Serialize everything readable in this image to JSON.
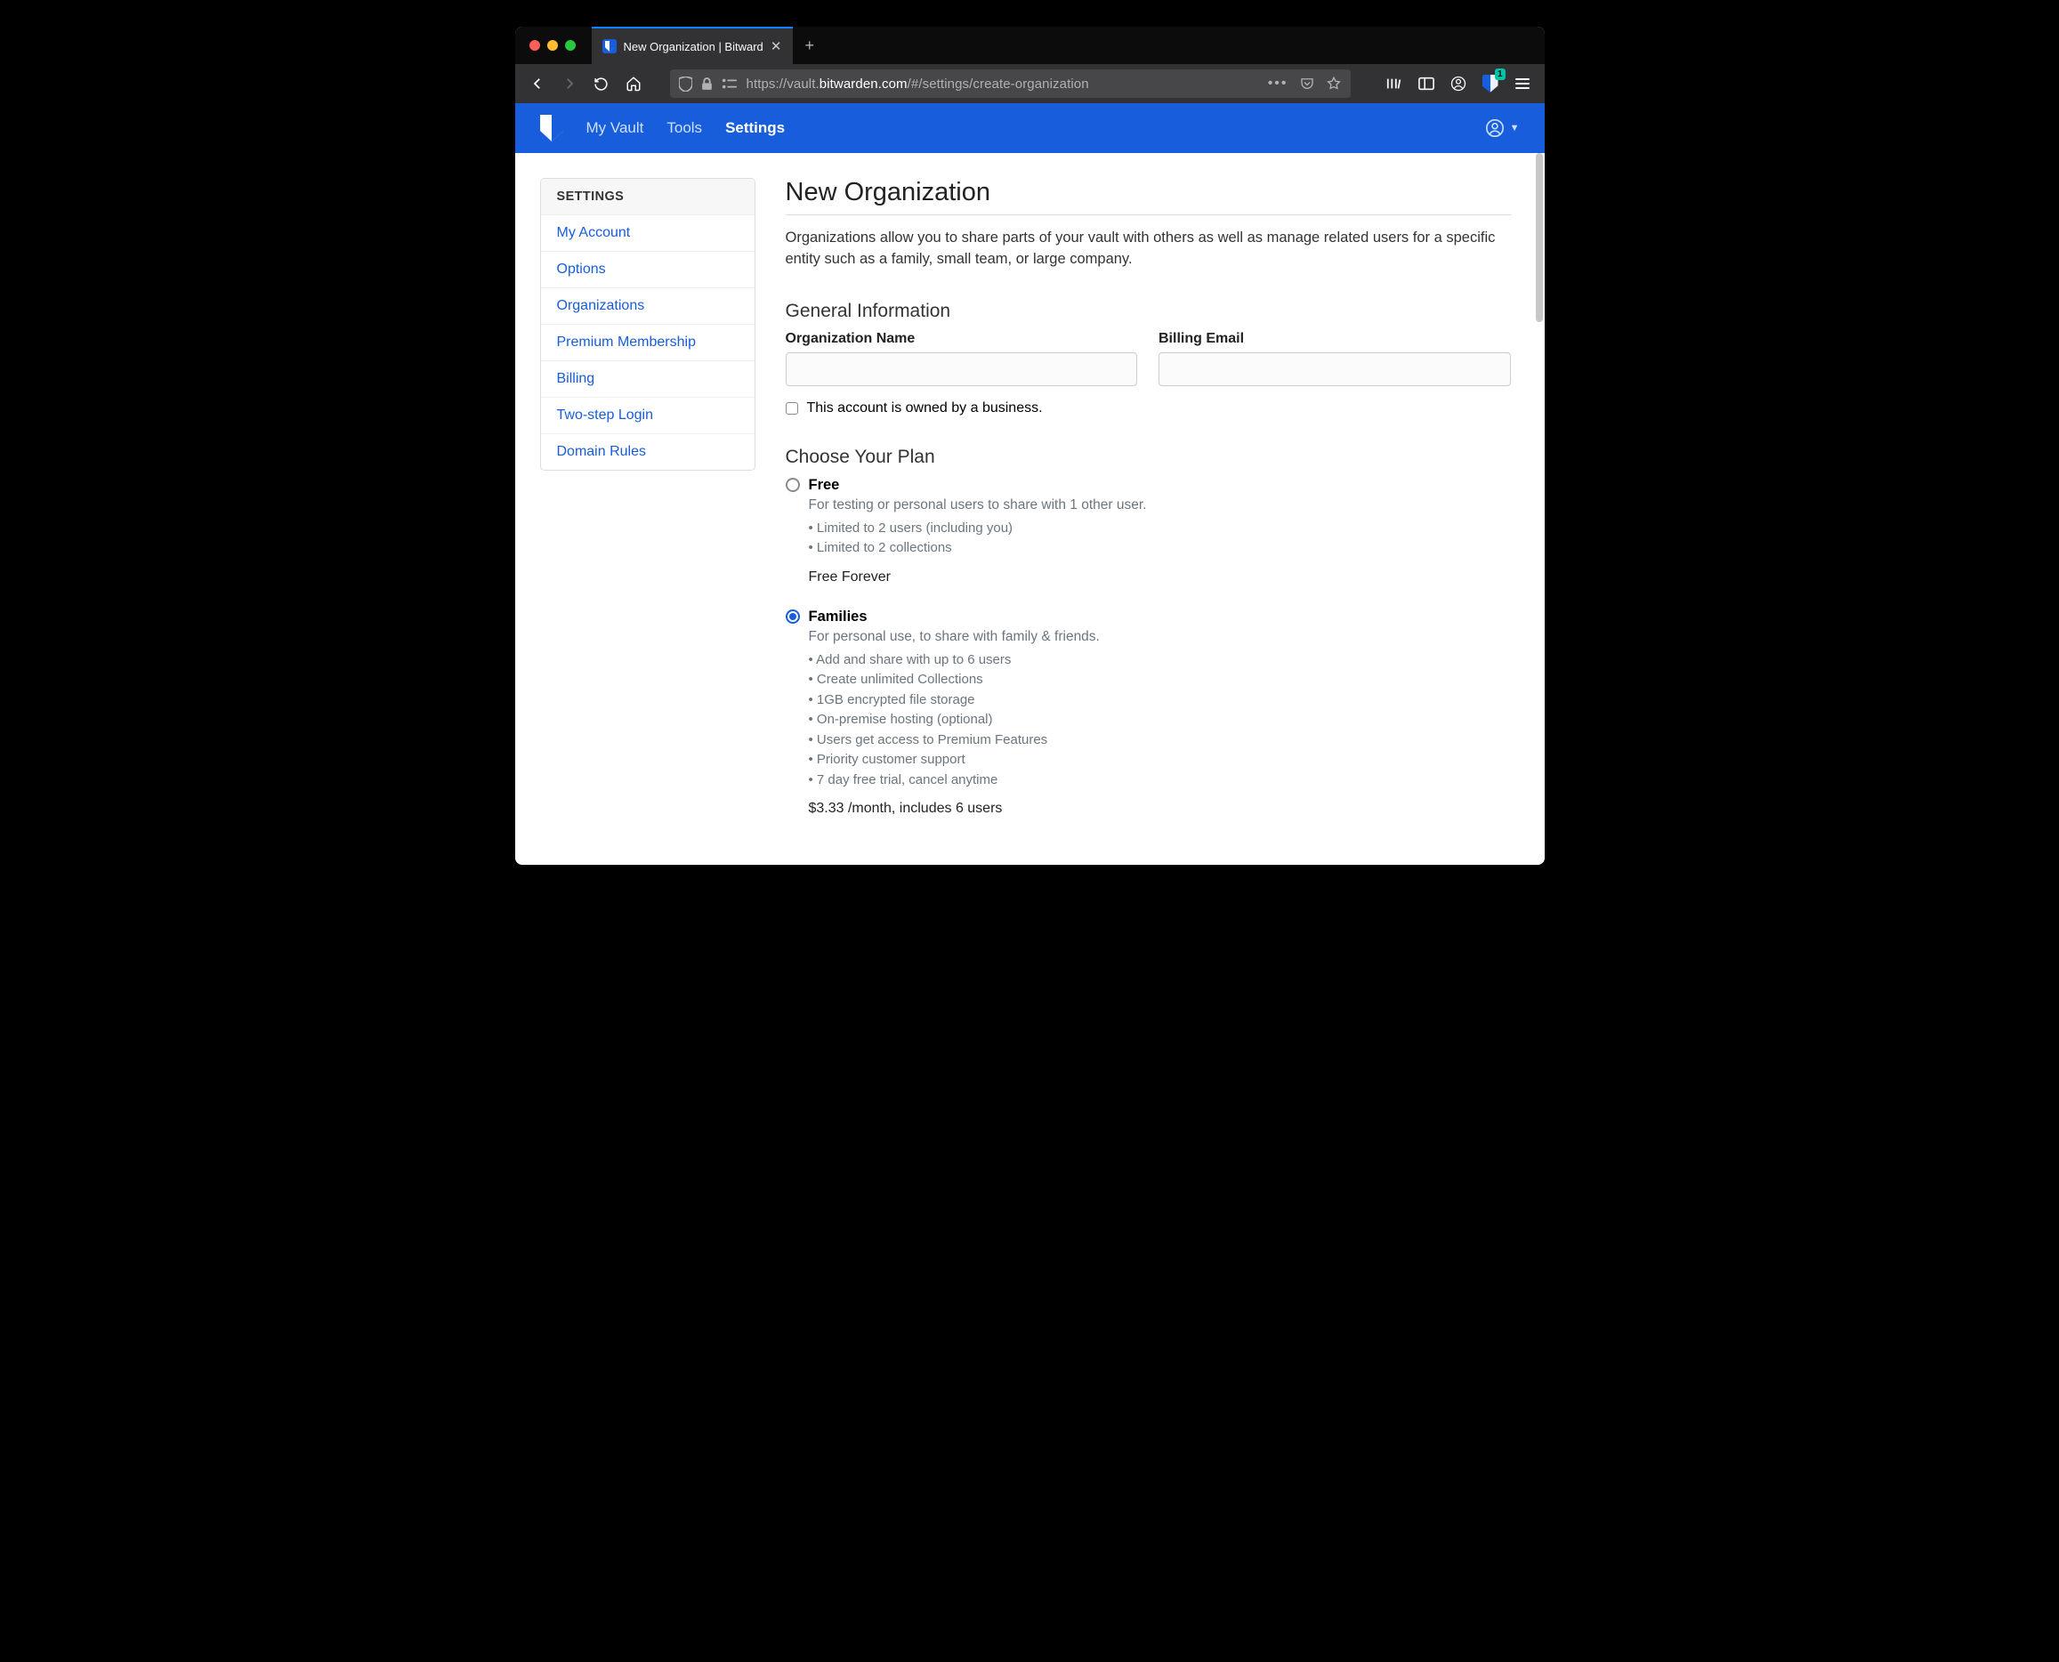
{
  "browser": {
    "tab_title": "New Organization | Bitwarden V",
    "url_pre": "https://vault.",
    "url_host": "bitwarden.com",
    "url_post": "/#/settings/create-organization",
    "ext_count": "1"
  },
  "nav": {
    "items": [
      "My Vault",
      "Tools",
      "Settings"
    ],
    "active_index": 2
  },
  "sidebar": {
    "heading": "SETTINGS",
    "items": [
      "My Account",
      "Options",
      "Organizations",
      "Premium Membership",
      "Billing",
      "Two-step Login",
      "Domain Rules"
    ]
  },
  "page": {
    "title": "New Organization",
    "lead": "Organizations allow you to share parts of your vault with others as well as manage related users for a specific entity such as a family, small team, or large company.",
    "section_general": "General Information",
    "label_orgname": "Organization Name",
    "label_email": "Billing Email",
    "chk_business": "This account is owned by a business.",
    "section_plan": "Choose Your Plan",
    "plans": [
      {
        "name": "Free",
        "subtitle": "For testing or personal users to share with 1 other user.",
        "features": [
          "• Limited to 2 users (including you)",
          "• Limited to 2 collections"
        ],
        "price": "Free Forever",
        "selected": false
      },
      {
        "name": "Families",
        "subtitle": "For personal use, to share with family & friends.",
        "features": [
          "• Add and share with up to 6 users",
          "• Create unlimited Collections",
          "• 1GB encrypted file storage",
          "• On-premise hosting (optional)",
          "• Users get access to Premium Features",
          "• Priority customer support",
          "• 7 day free trial, cancel anytime"
        ],
        "price": "$3.33 /month, includes 6 users",
        "selected": true
      }
    ]
  }
}
